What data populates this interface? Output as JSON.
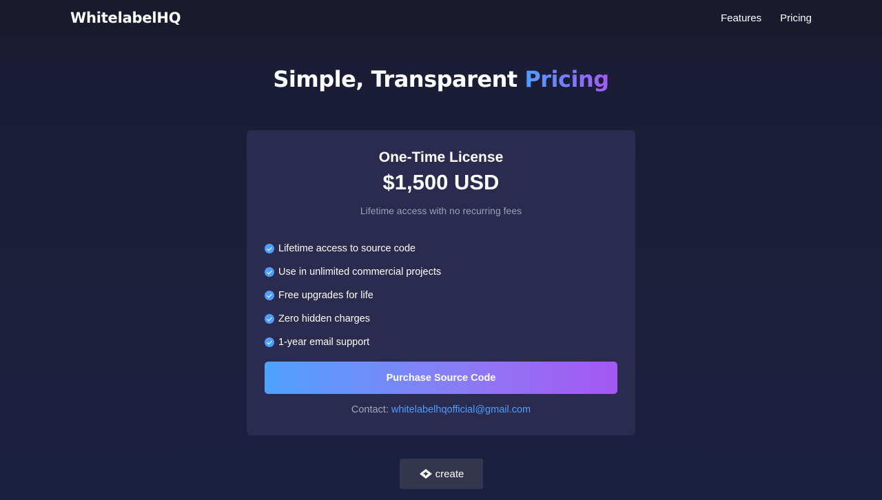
{
  "header": {
    "logo": "WhitelabelHQ",
    "nav": [
      "Features",
      "Pricing"
    ]
  },
  "hero": {
    "title_main": "Simple, Transparent",
    "title_accent": "Pricing"
  },
  "card": {
    "title": "One-Time License",
    "price": "$1,500 USD",
    "subtitle": "Lifetime access with no recurring fees",
    "features": [
      "Lifetime access to source code",
      "Use in unlimited commercial projects",
      "Free upgrades for life",
      "Zero hidden charges",
      "1-year email support"
    ],
    "button_label": "Purchase Source Code",
    "contact_label": "Contact:",
    "contact_email": "whitelabelhqofficial@gmail.com"
  },
  "badge": {
    "label": "create",
    "icon": "create-logo-icon"
  },
  "colors": {
    "accent_blue": "#4f9dff",
    "accent_purple": "#a557f3",
    "card_bg": "#2a2b4f",
    "page_bg": "#1b1e37"
  }
}
